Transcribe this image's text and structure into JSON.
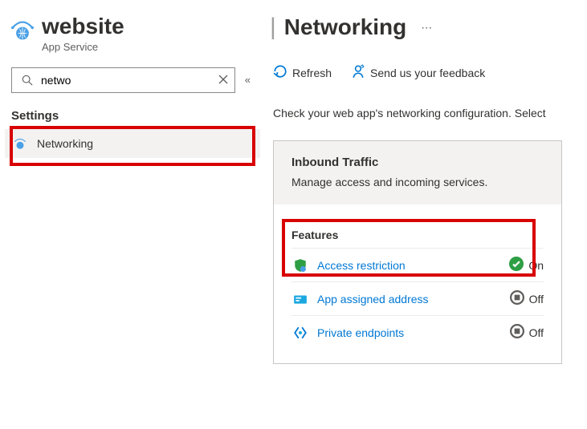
{
  "resource": {
    "name": "website",
    "type": "App Service"
  },
  "search": {
    "value": "netwo",
    "placeholder": ""
  },
  "sidebar": {
    "section_label": "Settings",
    "items": [
      {
        "label": "Networking"
      }
    ]
  },
  "blade": {
    "title": "Networking"
  },
  "commands": {
    "refresh": "Refresh",
    "feedback": "Send us your feedback"
  },
  "description": "Check your web app's networking configuration. Select",
  "card": {
    "title": "Inbound Traffic",
    "subtitle": "Manage access and incoming services.",
    "features_label": "Features",
    "features": [
      {
        "label": "Access restriction",
        "state": "On"
      },
      {
        "label": "App assigned address",
        "state": "Off"
      },
      {
        "label": "Private endpoints",
        "state": "Off"
      }
    ]
  }
}
